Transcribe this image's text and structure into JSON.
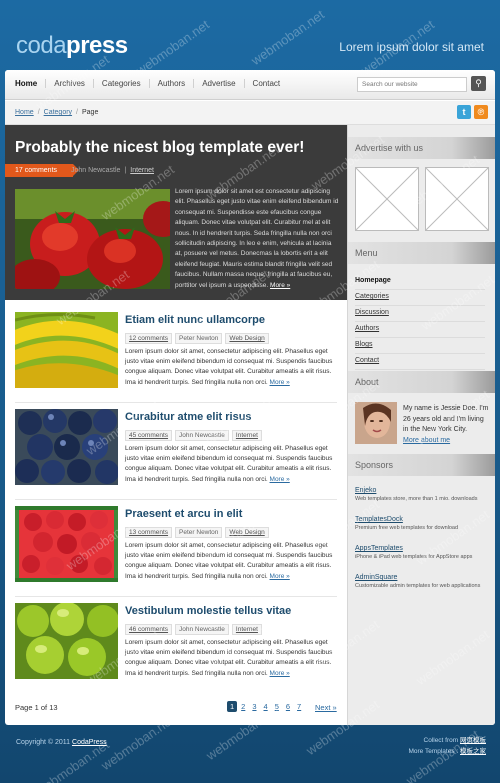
{
  "header": {
    "logo_light": "coda",
    "logo_bold": "press",
    "tagline": "Lorem ipsum dolor sit amet"
  },
  "nav": {
    "items": [
      "Home",
      "Archives",
      "Categories",
      "Authors",
      "Advertise",
      "Contact"
    ],
    "search_placeholder": "Search our website"
  },
  "breadcrumb": {
    "home": "Home",
    "category": "Category",
    "current": "Page"
  },
  "featured": {
    "title": "Probably the nicest blog template ever!",
    "comments": "17 comments",
    "author": "John Newcastle",
    "category": "Internet",
    "text": "Lorem ipsum dolor sit amet est consectetur adipiscing elit. Phasellus eget justo vitae enim eleifend bibendum id consequat mi. Suspendisse este efaucibus congue aliquam. Donec vitae volutpat elit. Curabitur mel at elit nous. In id hendrerit turpis. Seda fringilla nulla non orci sollicitudin adipiscing. In leo e enim, vehicula at lacinia at, posuere vel metus. Donecmas la lobortis erit a elit eleifend feugiat. Mauris estima blandit fringilla velit sed faucibus. Nullam massa neque, fringilla at faucibus eu, porttitor vel ipsum a uspendisse.",
    "more": "More »"
  },
  "posts": [
    {
      "title": "Etiam elit nunc ullamcorpe",
      "comments": "12 comments",
      "author": "Peter Newton",
      "category": "Web Design",
      "excerpt": "Lorem ipsum dolor sit amet, consectetur adipiscing elit. Phasellus eget justo vitae enim eleifend bibendum id consequat mi. Suspendis faucibus congue aliquam. Donec vitae volutpat elit. Curabitur ameatis a elit risus. Ima id hendrerit turpis. Sed fringilla nulla non orci.",
      "more": "More »"
    },
    {
      "title": "Curabitur atme elit risus",
      "comments": "45 comments",
      "author": "John Newcastle",
      "category": "Internet",
      "excerpt": "Lorem ipsum dolor sit amet, consectetur adipiscing elit. Phasellus eget justo vitae enim eleifend bibendum id consequat mi. Suspendis faucibus congue aliquam. Donec vitae volutpat elit. Curabitur ameatis a elit risus. Ima id hendrerit turpis. Sed fringilla nulla non orci.",
      "more": "More »"
    },
    {
      "title": "Praesent et arcu in elit",
      "comments": "13 comments",
      "author": "Peter Newton",
      "category": "Web Design",
      "excerpt": "Lorem ipsum dolor sit amet, consectetur adipiscing elit. Phasellus eget justo vitae enim eleifend bibendum id consequat mi. Suspendis faucibus congue aliquam. Donec vitae volutpat elit. Curabitur ameatis a elit risus. Ima id hendrerit turpis. Sed fringilla nulla non orci.",
      "more": "More »"
    },
    {
      "title": "Vestibulum molestie tellus vitae",
      "comments": "46 comments",
      "author": "John Newcastle",
      "category": "Internet",
      "excerpt": "Lorem ipsum dolor sit amet, consectetur adipiscing elit. Phasellus eget justo vitae enim eleifend bibendum id consequat mi. Suspendis faucibus congue aliquam. Donec vitae volutpat elit. Curabitur ameatis a elit risus. Ima id hendrerit turpis. Sed fringilla nulla non orci.",
      "more": "More »"
    }
  ],
  "pagination": {
    "label": "Page 1 of 13",
    "pages": [
      "1",
      "2",
      "3",
      "4",
      "5",
      "6",
      "7"
    ],
    "current": "1",
    "next": "Next »"
  },
  "sidebar": {
    "advertise_title": "Advertise with us",
    "menu_title": "Menu",
    "menu_items": [
      "Homepage",
      "Categories",
      "Discussion",
      "Authors",
      "Blogs",
      "Contact"
    ],
    "about_title": "About",
    "about_text": "My name is Jessie Doe. I'm 26 years old and I'm living in the New York City.",
    "about_more": "More about me",
    "sponsors_title": "Sponsors",
    "sponsors": [
      {
        "name": "Enjeko",
        "desc": "Web templates store, more than 1 mio. downloads"
      },
      {
        "name": "TemplatesDock",
        "desc": "Premium free web templates for download"
      },
      {
        "name": "AppsTemplates",
        "desc": "iPhone & iPad web templates for AppStore apps"
      },
      {
        "name": "AdminSquare",
        "desc": "Customizable admin templates for web applications"
      }
    ]
  },
  "footer": {
    "copyright": "Copyright © 2011",
    "brand": "CodaPress",
    "collect_label": "Collect from",
    "collect_link": "网页模板",
    "more_label": "More Templates",
    "more_link": "模板之家"
  },
  "watermark": "webmoban.net",
  "colors": {
    "background": "#185a8a",
    "accent_orange": "#e2581b",
    "title_blue": "#1e4c6d",
    "featured_bg": "#3b3b3b"
  }
}
